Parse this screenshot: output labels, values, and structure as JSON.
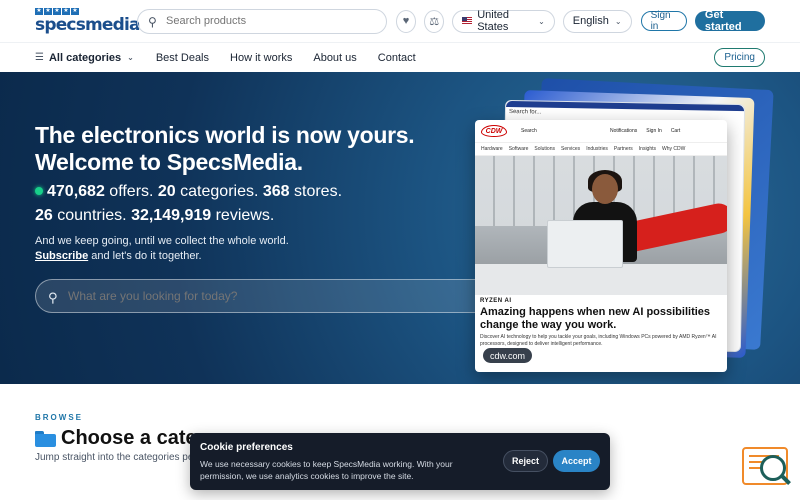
{
  "header": {
    "logo_text": "specsmedia",
    "logo_stars": [
      "★",
      "★",
      "★",
      "★",
      "★"
    ],
    "search_placeholder": "Search products",
    "country": "United States",
    "language": "English",
    "signin_label": "Sign in",
    "getstarted_label": "Get started",
    "icons": {
      "search": "search-icon",
      "wishlist": "heart-icon",
      "compare": "scale-icon",
      "flag": "us-flag-icon"
    }
  },
  "nav": {
    "categories_label": "All categories",
    "links": [
      "Best Deals",
      "How it works",
      "About us",
      "Contact"
    ],
    "pricing_label": "Pricing"
  },
  "hero": {
    "title_line1": "The electronics world is now yours.",
    "title_line2": "Welcome to SpecsMedia.",
    "stats": {
      "offers_count": "470,682",
      "offers_label": " offers. ",
      "categories_count": "20",
      "categories_label": " categories. ",
      "stores_count": "368",
      "stores_label": " stores.",
      "countries_count": "26",
      "countries_label": " countries. ",
      "reviews_count": "32,149,919",
      "reviews_label": " reviews."
    },
    "sub_line1": "And we keep going, until we collect the whole world.",
    "subscribe_label": "Subscribe",
    "sub_line2_rest": " and let's do it together.",
    "search_placeholder": "What are you looking for today?",
    "card": {
      "logo": "CDW",
      "search": "Search",
      "top_items": [
        "Notifications",
        "Sign In",
        "Cart"
      ],
      "menu": [
        "Hardware",
        "Software",
        "Solutions",
        "Services",
        "Industries",
        "Partners",
        "Insights",
        "Why CDW"
      ],
      "brand_line": "RYZEN AI",
      "headline": "Amazing happens when new AI possibilities change the way you work.",
      "body": "Discover AI technology to help you tackle your goals, including Windows PCs powered by AMD Ryzen™ AI processors, designed to deliver intelligent performance.",
      "domain_badge": "cdw.com"
    },
    "back_card_text": "Search for..."
  },
  "browse": {
    "eyebrow": "BROWSE",
    "title": "Choose a category",
    "subtitle": "Jump straight into the categories people love most."
  },
  "cookie": {
    "title": "Cookie preferences",
    "text": "We use necessary cookies to keep SpecsMedia working. With your permission, we use analytics cookies to improve the site.",
    "reject_label": "Reject",
    "accept_label": "Accept"
  },
  "colors": {
    "primary": "#1f6f9f",
    "accent_green": "#18d08a",
    "hero_dark": "#0f3258",
    "cookie_bg": "#151c29",
    "widget_orange": "#f08a2a"
  }
}
